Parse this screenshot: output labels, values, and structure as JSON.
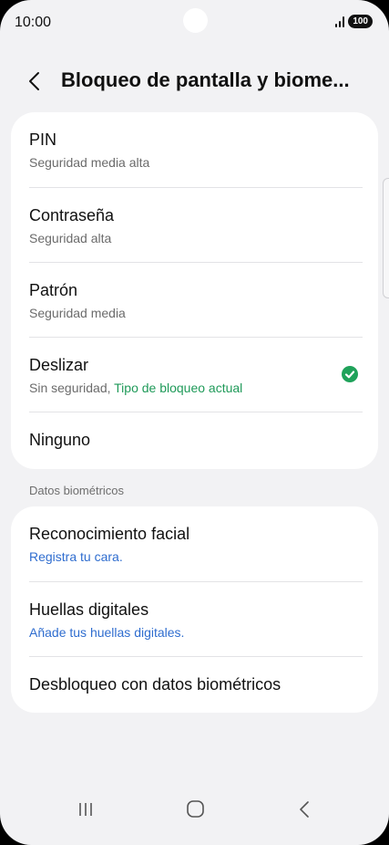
{
  "status_bar": {
    "time": "10:00",
    "battery": "100",
    "icons": [
      "signal-icon",
      "battery-icon"
    ]
  },
  "header": {
    "back_icon": "chevron-left-icon",
    "title": "Bloqueo de pantalla y biome..."
  },
  "lock_types": [
    {
      "title": "PIN",
      "subtitle": "Seguridad media alta"
    },
    {
      "title": "Contraseña",
      "subtitle": "Seguridad alta"
    },
    {
      "title": "Patrón",
      "subtitle": "Seguridad media"
    },
    {
      "title": "Deslizar",
      "subtitle": "Sin seguridad, ",
      "subtitle_accent": "Tipo de bloqueo actual",
      "selected": true,
      "selected_icon": "check-circle-icon"
    },
    {
      "title": "Ninguno"
    }
  ],
  "biometrics": {
    "section_title": "Datos biométricos",
    "items": [
      {
        "title": "Reconocimiento facial",
        "subtitle": "Registra tu cara."
      },
      {
        "title": "Huellas digitales",
        "subtitle": "Añade tus huellas digitales."
      },
      {
        "title": "Desbloqueo con datos biométricos"
      }
    ]
  },
  "nav_bar": {
    "recents_icon": "recents-icon",
    "home_icon": "home-icon",
    "back_icon": "back-icon"
  },
  "colors": {
    "background": "#f2f2f4",
    "card": "#ffffff",
    "accent_green": "#1f9a59",
    "link_blue": "#2f6dcf"
  }
}
